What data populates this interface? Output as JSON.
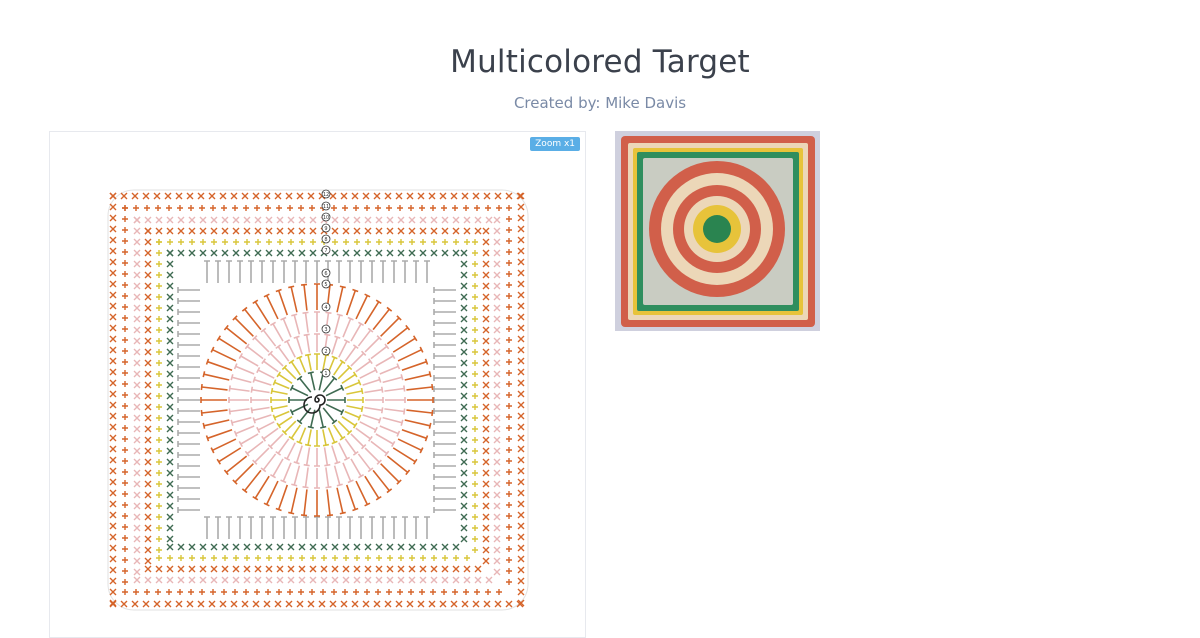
{
  "page": {
    "title": "Multicolored Target",
    "creator_line": "Created by: Mike Davis"
  },
  "diagram": {
    "zoom_label": "Zoom x1",
    "round_markers": [
      "12",
      "11",
      "10",
      "9",
      "8",
      "7",
      "6",
      "5",
      "4",
      "3",
      "2",
      "1"
    ],
    "colors": {
      "orange": "#d5642a",
      "pink": "#e8b6b7",
      "gray": "#ababab",
      "yellow": "#d9c63a",
      "green": "#3f6b52",
      "dark": "#222222"
    },
    "icons": [
      "zoom-icon",
      "magic-ring-icon"
    ]
  },
  "photo": {
    "colors": {
      "background": "#cfd0de",
      "border": "#d15f4a",
      "cream": "#ecd7b8",
      "green": "#2f8e5e",
      "yellow": "#e7c33a",
      "light_gray": "#c9ccc2",
      "center": "#2a8450"
    }
  }
}
